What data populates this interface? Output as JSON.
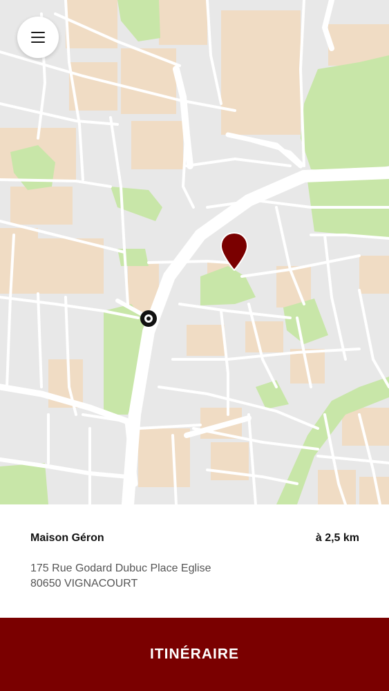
{
  "colors": {
    "accent": "#7a0000",
    "park": "#c8e6a8",
    "building": "#f0dcc4",
    "road": "#ffffff",
    "land": "#e8e8e8"
  },
  "header": {
    "menu_icon": "hamburger-menu-icon"
  },
  "map": {
    "destination_icon": "map-pin-icon",
    "user_location_icon": "current-location-icon"
  },
  "place": {
    "name": "Maison Géron",
    "distance": "à 2,5 km",
    "address_line1": "175 Rue Godard Dubuc Place Eglise",
    "address_line2": "80650 VIGNACOURT"
  },
  "actions": {
    "route_label": "ITINÉRAIRE"
  }
}
